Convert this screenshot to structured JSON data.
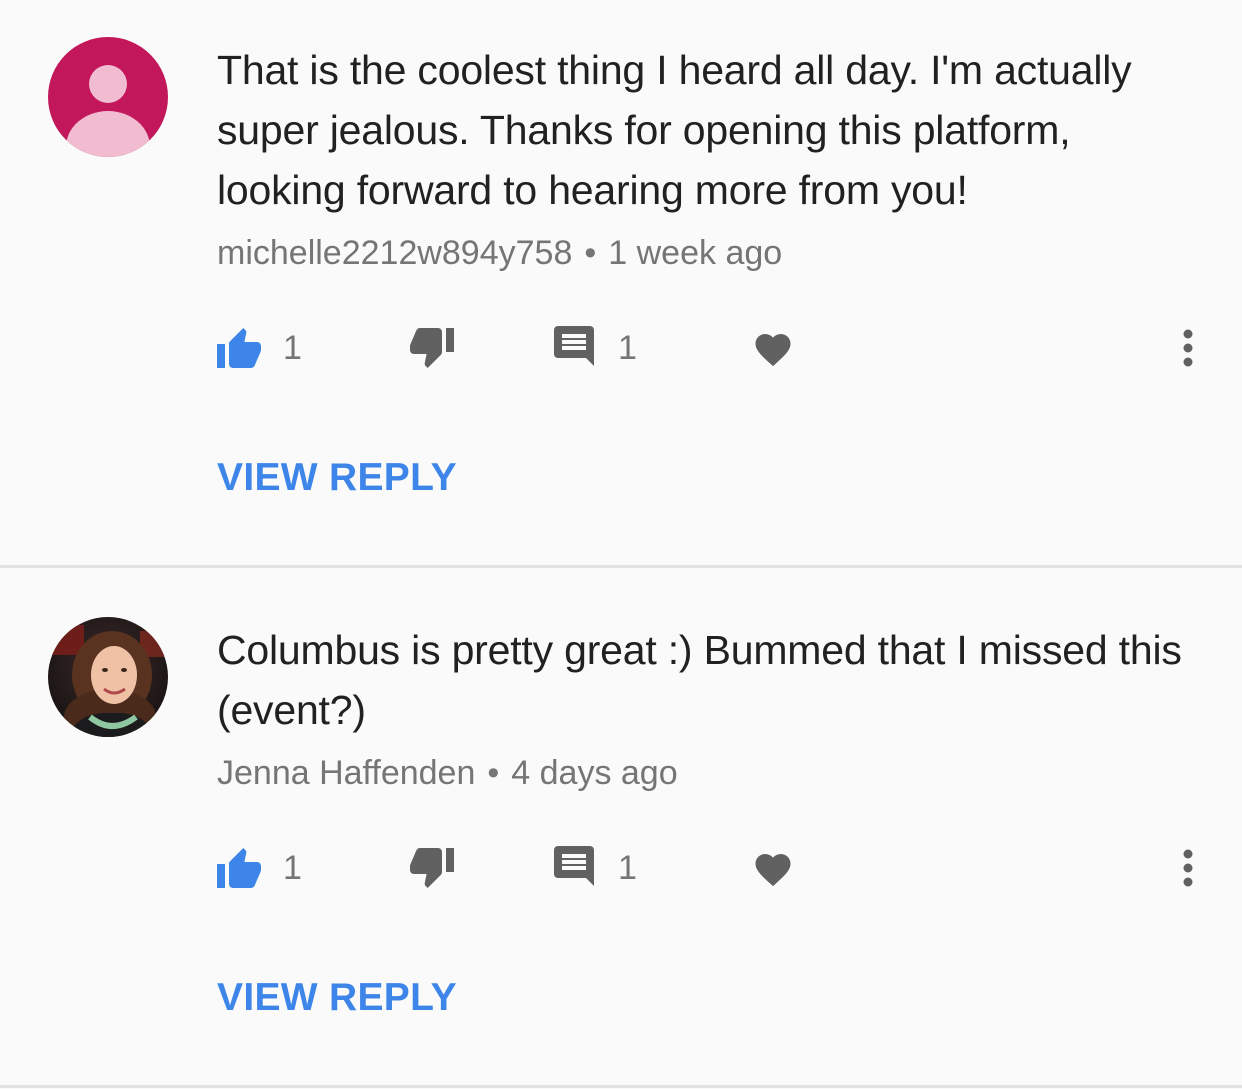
{
  "comments": [
    {
      "avatar": {
        "type": "default-person",
        "background": "#c2185b",
        "foreground": "#f2bcd0"
      },
      "text": "That is the coolest thing I heard all day. I'm actually super jealous. Thanks for opening this platform, looking forward to hearing more from you!",
      "author": "michelle2212w894y758",
      "separator": "•",
      "time": "1 week ago",
      "likes": "1",
      "replies": "1",
      "liked": true,
      "view_reply_label": "VIEW REPLY"
    },
    {
      "avatar": {
        "type": "photo"
      },
      "text": "Columbus is pretty great :) Bummed that I missed this (event?)",
      "author": "Jenna Haffenden",
      "separator": "•",
      "time": "4 days ago",
      "likes": "1",
      "replies": "1",
      "liked": true,
      "view_reply_label": "VIEW REPLY"
    }
  ],
  "colors": {
    "accent": "#3d85e8",
    "icon_gray": "#616161",
    "meta_gray": "#757575",
    "text": "#212121",
    "divider": "#e3e3e3"
  },
  "icons": [
    "thumb-up-icon",
    "thumb-down-icon",
    "comment-icon",
    "heart-icon",
    "more-vert-icon"
  ]
}
